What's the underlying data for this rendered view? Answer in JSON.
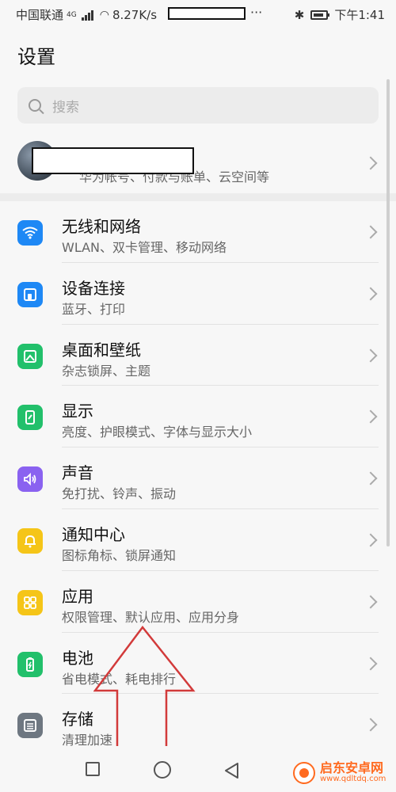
{
  "status_bar": {
    "carrier": "中国联通",
    "network": "4G",
    "speed": "8.27K/s",
    "more": "···",
    "time": "下午1:41"
  },
  "header": {
    "title": "设置"
  },
  "search": {
    "placeholder": "搜索"
  },
  "account": {
    "name": "",
    "subtitle": "华为帐号、付款与账单、云空间等"
  },
  "settings": {
    "items": [
      {
        "title": "无线和网络",
        "subtitle": "WLAN、双卡管理、移动网络",
        "icon": "wifi-icon",
        "color": "#1e88f5"
      },
      {
        "title": "设备连接",
        "subtitle": "蓝牙、打印",
        "icon": "device-connection-icon",
        "color": "#1e88f5"
      },
      {
        "title": "桌面和壁纸",
        "subtitle": "杂志锁屏、主题",
        "icon": "wallpaper-icon",
        "color": "#22c06b"
      },
      {
        "title": "显示",
        "subtitle": "亮度、护眼模式、字体与显示大小",
        "icon": "display-icon",
        "color": "#22c06b"
      },
      {
        "title": "声音",
        "subtitle": "免打扰、铃声、振动",
        "icon": "sound-icon",
        "color": "#8a62f0"
      },
      {
        "title": "通知中心",
        "subtitle": "图标角标、锁屏通知",
        "icon": "bell-icon",
        "color": "#f5c518"
      },
      {
        "title": "应用",
        "subtitle": "权限管理、默认应用、应用分身",
        "icon": "apps-icon",
        "color": "#f5c518"
      },
      {
        "title": "电池",
        "subtitle": "省电模式、耗电排行",
        "icon": "battery-icon",
        "color": "#22c06b"
      },
      {
        "title": "存储",
        "subtitle": "清理加速",
        "icon": "storage-icon",
        "color": "#6e7781"
      }
    ]
  },
  "watermark": {
    "line1": "启东安卓网",
    "line2": "www.qdltdq.com"
  }
}
